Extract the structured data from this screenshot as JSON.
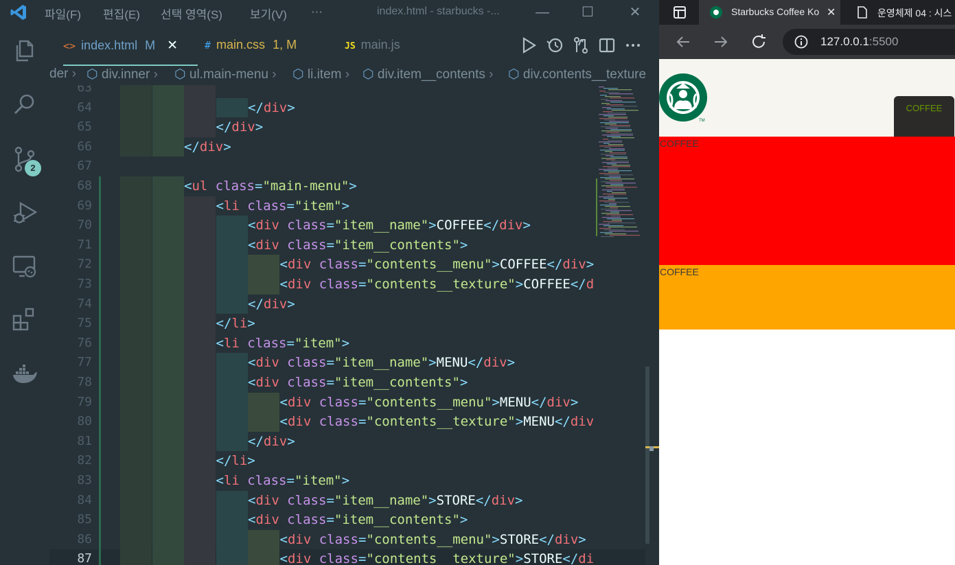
{
  "titlebar": {
    "menus": [
      "파일(F)",
      "편집(E)",
      "선택 영역(S)",
      "보기(V)",
      "···"
    ],
    "window_title": "index.html - starbucks -...",
    "minimize": "—",
    "maximize": "☐",
    "close": "✕"
  },
  "activity": {
    "scm_badge": "2"
  },
  "tabs": [
    {
      "icon": "<>",
      "name": "index.html",
      "status": "M",
      "close": "✕"
    },
    {
      "icon": "#",
      "name": "main.css",
      "status": "1, M"
    },
    {
      "icon": "JS",
      "name": "main.js",
      "status": ""
    }
  ],
  "breadcrumb": [
    "der",
    "div.inner",
    "ul.main-menu",
    "li.item",
    "div.item__contents",
    "div.contents__texture"
  ],
  "editor": {
    "lines": [
      {
        "n": "63",
        "indent": 3,
        "code": [
          [
            "txt",
            "       "
          ]
        ]
      },
      {
        "n": "64",
        "indent": 4,
        "code": [
          [
            "tag",
            "</"
          ],
          [
            "name",
            "div"
          ],
          [
            "tag",
            ">"
          ]
        ]
      },
      {
        "n": "65",
        "indent": 3,
        "code": [
          [
            "tag",
            "</"
          ],
          [
            "name",
            "div"
          ],
          [
            "tag",
            ">"
          ]
        ]
      },
      {
        "n": "66",
        "indent": 2,
        "code": [
          [
            "tag",
            "</"
          ],
          [
            "name",
            "div"
          ],
          [
            "tag",
            ">"
          ]
        ]
      },
      {
        "n": "67",
        "indent": 0,
        "code": []
      },
      {
        "n": "68",
        "indent": 2,
        "code": [
          [
            "tag",
            "<"
          ],
          [
            "name",
            "ul"
          ],
          [
            "txt",
            " "
          ],
          [
            "attr",
            "class"
          ],
          [
            "eq",
            "="
          ],
          [
            "str",
            "\"main-menu\""
          ],
          [
            "tag",
            ">"
          ]
        ]
      },
      {
        "n": "69",
        "indent": 3,
        "code": [
          [
            "tag",
            "<"
          ],
          [
            "name",
            "li"
          ],
          [
            "txt",
            " "
          ],
          [
            "attr",
            "class"
          ],
          [
            "eq",
            "="
          ],
          [
            "str",
            "\"item\""
          ],
          [
            "tag",
            ">"
          ]
        ]
      },
      {
        "n": "70",
        "indent": 4,
        "code": [
          [
            "tag",
            "<"
          ],
          [
            "name",
            "div"
          ],
          [
            "txt",
            " "
          ],
          [
            "attr",
            "class"
          ],
          [
            "eq",
            "="
          ],
          [
            "str",
            "\"item__name\""
          ],
          [
            "tag",
            ">"
          ],
          [
            "txt",
            "COFFEE"
          ],
          [
            "tag",
            "</"
          ],
          [
            "name",
            "div"
          ],
          [
            "tag",
            ">"
          ]
        ]
      },
      {
        "n": "71",
        "indent": 4,
        "code": [
          [
            "tag",
            "<"
          ],
          [
            "name",
            "div"
          ],
          [
            "txt",
            " "
          ],
          [
            "attr",
            "class"
          ],
          [
            "eq",
            "="
          ],
          [
            "str",
            "\"item__contents\""
          ],
          [
            "tag",
            ">"
          ]
        ]
      },
      {
        "n": "72",
        "indent": 5,
        "code": [
          [
            "tag",
            "<"
          ],
          [
            "name",
            "div"
          ],
          [
            "txt",
            " "
          ],
          [
            "attr",
            "class"
          ],
          [
            "eq",
            "="
          ],
          [
            "str",
            "\"contents__menu\""
          ],
          [
            "tag",
            ">"
          ],
          [
            "txt",
            "COFFEE"
          ],
          [
            "tag",
            "</"
          ],
          [
            "name",
            "div"
          ],
          [
            "tag",
            ">"
          ]
        ]
      },
      {
        "n": "73",
        "indent": 5,
        "code": [
          [
            "tag",
            "<"
          ],
          [
            "name",
            "div"
          ],
          [
            "txt",
            " "
          ],
          [
            "attr",
            "class"
          ],
          [
            "eq",
            "="
          ],
          [
            "str",
            "\"contents__texture\""
          ],
          [
            "tag",
            ">"
          ],
          [
            "txt",
            "COFFEE"
          ],
          [
            "tag",
            "</"
          ],
          [
            "name",
            "d"
          ]
        ]
      },
      {
        "n": "74",
        "indent": 4,
        "code": [
          [
            "tag",
            "</"
          ],
          [
            "name",
            "div"
          ],
          [
            "tag",
            ">"
          ]
        ]
      },
      {
        "n": "75",
        "indent": 3,
        "code": [
          [
            "tag",
            "</"
          ],
          [
            "name",
            "li"
          ],
          [
            "tag",
            ">"
          ]
        ]
      },
      {
        "n": "76",
        "indent": 3,
        "code": [
          [
            "tag",
            "<"
          ],
          [
            "name",
            "li"
          ],
          [
            "txt",
            " "
          ],
          [
            "attr",
            "class"
          ],
          [
            "eq",
            "="
          ],
          [
            "str",
            "\"item\""
          ],
          [
            "tag",
            ">"
          ]
        ]
      },
      {
        "n": "77",
        "indent": 4,
        "code": [
          [
            "tag",
            "<"
          ],
          [
            "name",
            "div"
          ],
          [
            "txt",
            " "
          ],
          [
            "attr",
            "class"
          ],
          [
            "eq",
            "="
          ],
          [
            "str",
            "\"item__name\""
          ],
          [
            "tag",
            ">"
          ],
          [
            "txt",
            "MENU"
          ],
          [
            "tag",
            "</"
          ],
          [
            "name",
            "div"
          ],
          [
            "tag",
            ">"
          ]
        ]
      },
      {
        "n": "78",
        "indent": 4,
        "code": [
          [
            "tag",
            "<"
          ],
          [
            "name",
            "div"
          ],
          [
            "txt",
            " "
          ],
          [
            "attr",
            "class"
          ],
          [
            "eq",
            "="
          ],
          [
            "str",
            "\"item__contents\""
          ],
          [
            "tag",
            ">"
          ]
        ]
      },
      {
        "n": "79",
        "indent": 5,
        "code": [
          [
            "tag",
            "<"
          ],
          [
            "name",
            "div"
          ],
          [
            "txt",
            " "
          ],
          [
            "attr",
            "class"
          ],
          [
            "eq",
            "="
          ],
          [
            "str",
            "\"contents__menu\""
          ],
          [
            "tag",
            ">"
          ],
          [
            "txt",
            "MENU"
          ],
          [
            "tag",
            "</"
          ],
          [
            "name",
            "div"
          ],
          [
            "tag",
            ">"
          ]
        ]
      },
      {
        "n": "80",
        "indent": 5,
        "code": [
          [
            "tag",
            "<"
          ],
          [
            "name",
            "div"
          ],
          [
            "txt",
            " "
          ],
          [
            "attr",
            "class"
          ],
          [
            "eq",
            "="
          ],
          [
            "str",
            "\"contents__texture\""
          ],
          [
            "tag",
            ">"
          ],
          [
            "txt",
            "MENU"
          ],
          [
            "tag",
            "</"
          ],
          [
            "name",
            "div"
          ]
        ]
      },
      {
        "n": "81",
        "indent": 4,
        "code": [
          [
            "tag",
            "</"
          ],
          [
            "name",
            "div"
          ],
          [
            "tag",
            ">"
          ]
        ]
      },
      {
        "n": "82",
        "indent": 3,
        "code": [
          [
            "tag",
            "</"
          ],
          [
            "name",
            "li"
          ],
          [
            "tag",
            ">"
          ]
        ]
      },
      {
        "n": "83",
        "indent": 3,
        "code": [
          [
            "tag",
            "<"
          ],
          [
            "name",
            "li"
          ],
          [
            "txt",
            " "
          ],
          [
            "attr",
            "class"
          ],
          [
            "eq",
            "="
          ],
          [
            "str",
            "\"item\""
          ],
          [
            "tag",
            ">"
          ]
        ]
      },
      {
        "n": "84",
        "indent": 4,
        "code": [
          [
            "tag",
            "<"
          ],
          [
            "name",
            "div"
          ],
          [
            "txt",
            " "
          ],
          [
            "attr",
            "class"
          ],
          [
            "eq",
            "="
          ],
          [
            "str",
            "\"item__name\""
          ],
          [
            "tag",
            ">"
          ],
          [
            "txt",
            "STORE"
          ],
          [
            "tag",
            "</"
          ],
          [
            "name",
            "div"
          ],
          [
            "tag",
            ">"
          ]
        ]
      },
      {
        "n": "85",
        "indent": 4,
        "code": [
          [
            "tag",
            "<"
          ],
          [
            "name",
            "div"
          ],
          [
            "txt",
            " "
          ],
          [
            "attr",
            "class"
          ],
          [
            "eq",
            "="
          ],
          [
            "str",
            "\"item__contents\""
          ],
          [
            "tag",
            ">"
          ]
        ]
      },
      {
        "n": "86",
        "indent": 5,
        "code": [
          [
            "tag",
            "<"
          ],
          [
            "name",
            "div"
          ],
          [
            "txt",
            " "
          ],
          [
            "attr",
            "class"
          ],
          [
            "eq",
            "="
          ],
          [
            "str",
            "\"contents__menu\""
          ],
          [
            "tag",
            ">"
          ],
          [
            "txt",
            "STORE"
          ],
          [
            "tag",
            "</"
          ],
          [
            "name",
            "div"
          ],
          [
            "tag",
            ">"
          ]
        ]
      },
      {
        "n": "87",
        "indent": 5,
        "current": true,
        "code": [
          [
            "tag",
            "<"
          ],
          [
            "name",
            "div"
          ],
          [
            "txt",
            " "
          ],
          [
            "attr",
            "class"
          ],
          [
            "eq",
            "="
          ],
          [
            "str",
            "\"contents__texture\""
          ],
          [
            "tag",
            ">"
          ],
          [
            "txt",
            "STORE"
          ],
          [
            "tag",
            "</"
          ],
          [
            "name",
            "di"
          ]
        ]
      }
    ]
  },
  "browser": {
    "tabs": [
      {
        "title": "Starbucks Coffee Ko",
        "close": "✕"
      },
      {
        "title": "운영체제 04 : 시스"
      }
    ],
    "url_host": "127.0.0.1",
    "url_port": ":5500",
    "page": {
      "coffee_button": "COFFEE",
      "red_box_text": "COFFEE",
      "orange_box_text": "COFFEE"
    }
  },
  "colors": {
    "editor_bg": "#263238",
    "tag": "#89ddff",
    "tag_name": "#f07178",
    "attr": "#c792ea",
    "string": "#c3e88d",
    "accent": "#80cbc4",
    "red_box": "#ff0000",
    "orange_box": "#ffa500",
    "starbucks_green": "#00704a"
  }
}
